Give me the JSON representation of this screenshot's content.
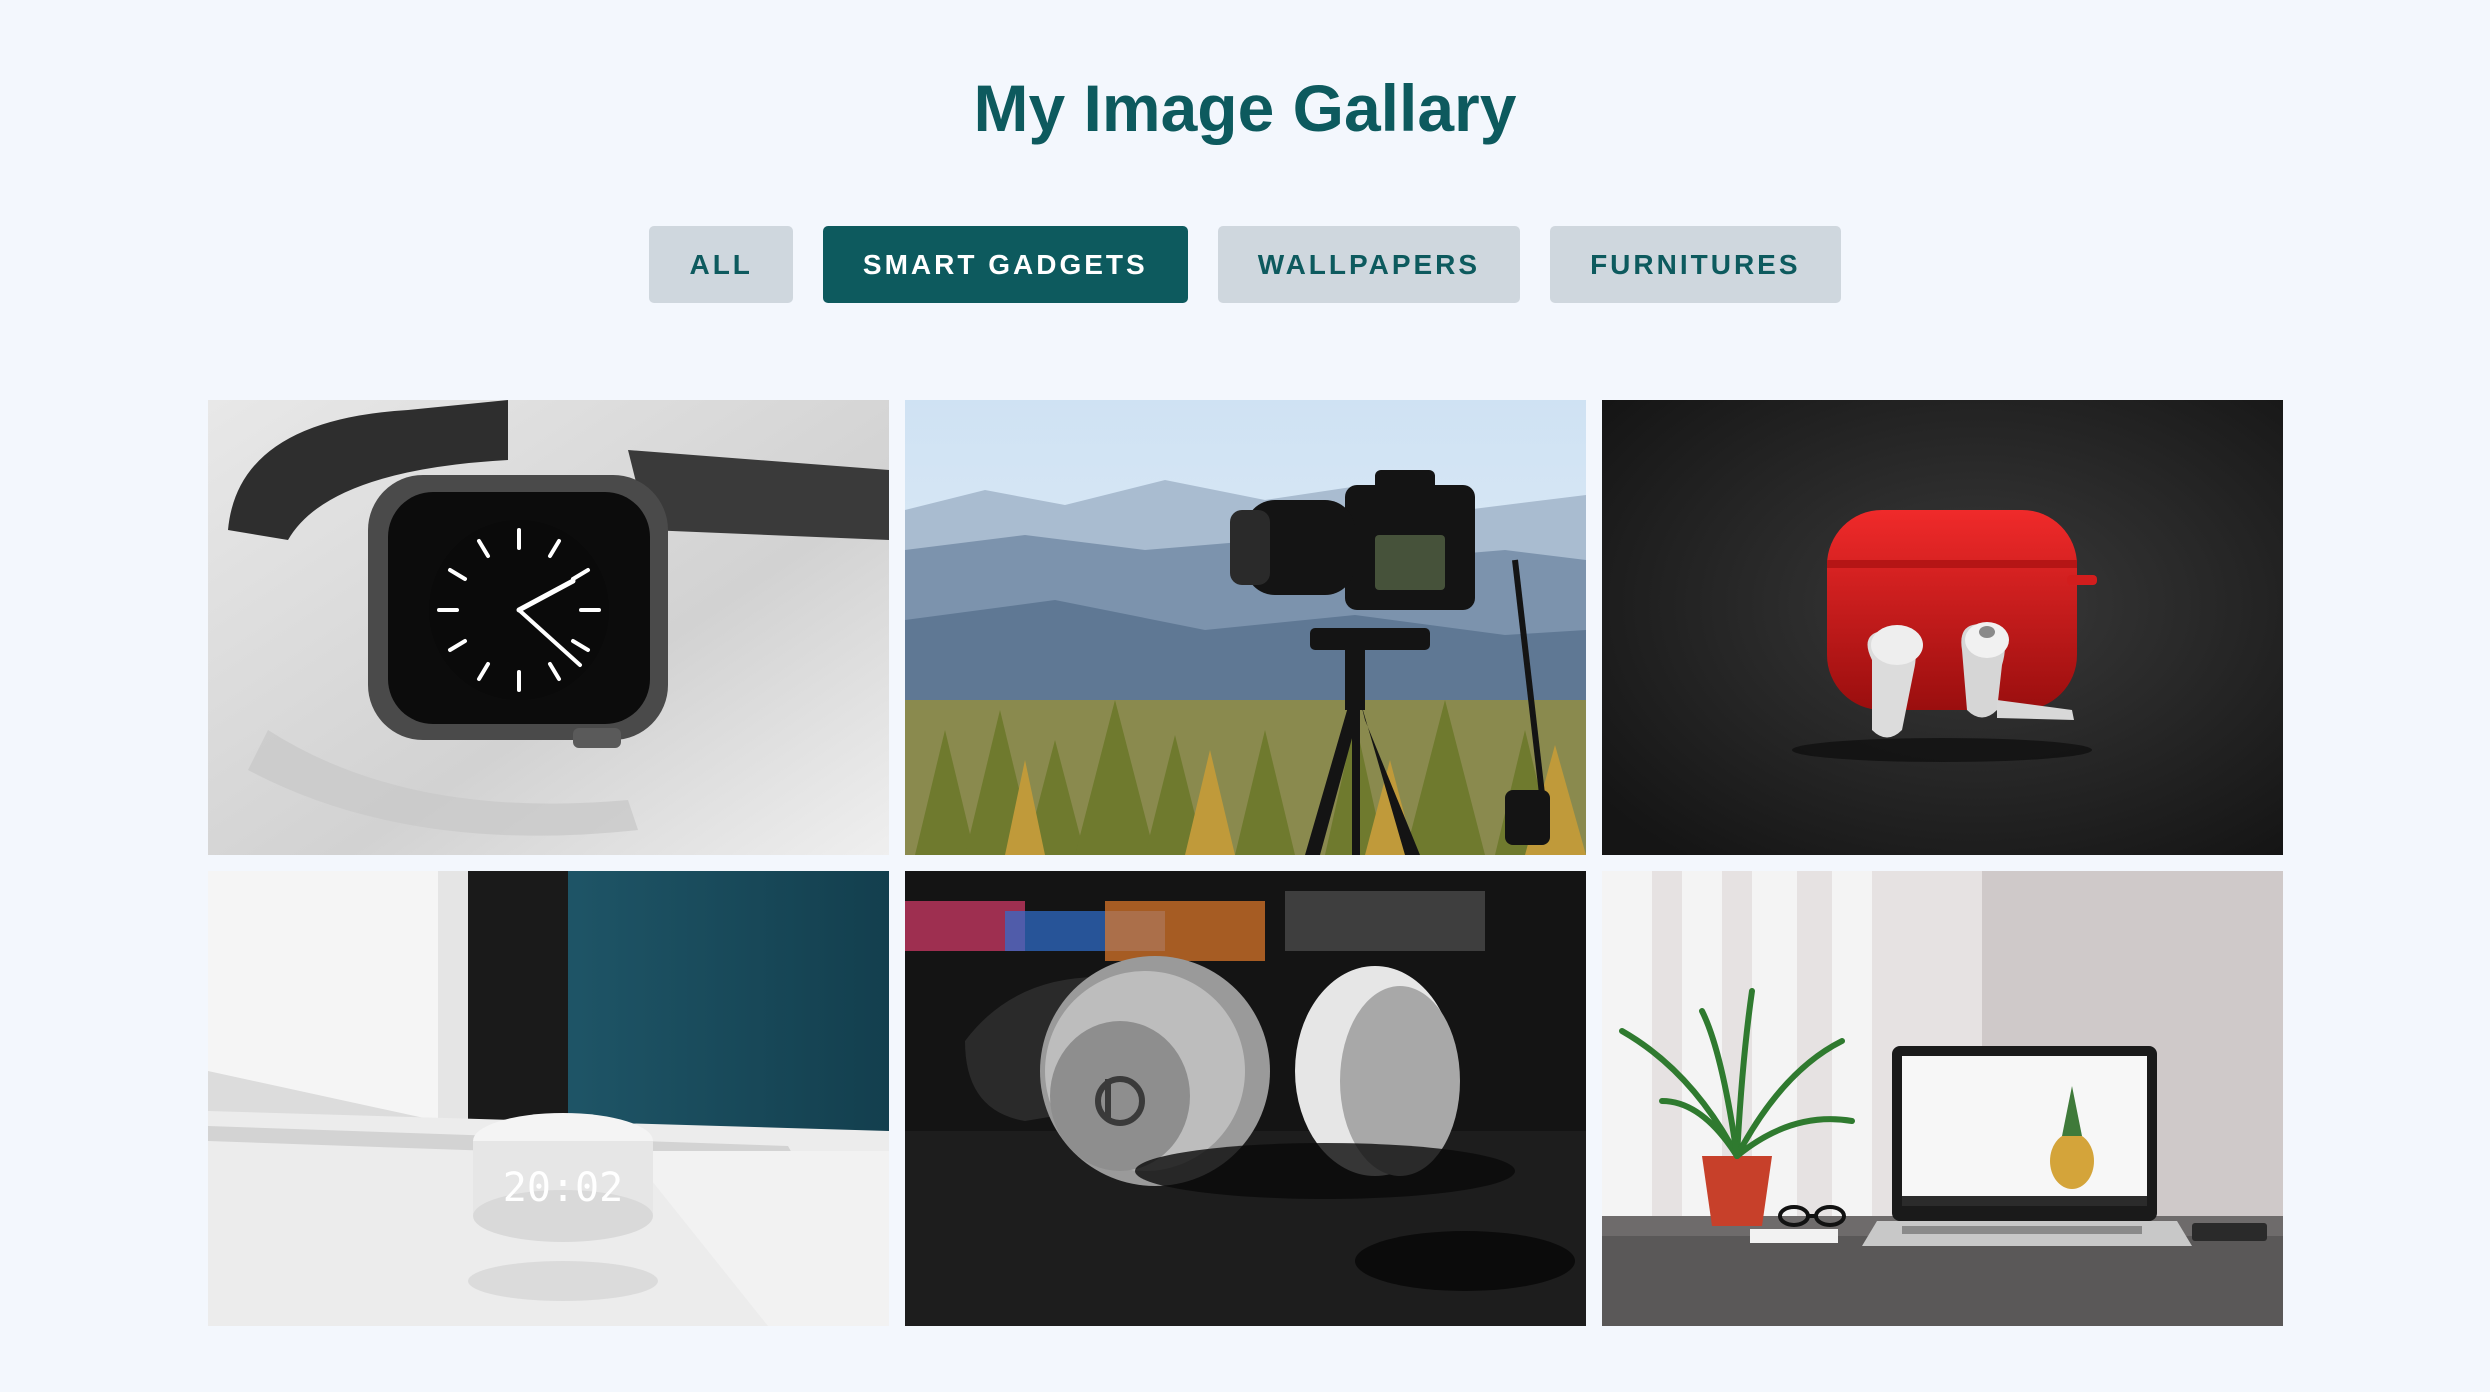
{
  "page": {
    "title": "My Image Gallary"
  },
  "filters": [
    {
      "label": "ALL",
      "active": false
    },
    {
      "label": "SMART GADGETS",
      "active": true
    },
    {
      "label": "WALLPAPERS",
      "active": false
    },
    {
      "label": "FURNITURES",
      "active": false
    }
  ],
  "gallery": {
    "images": [
      {
        "subject": "smart-watch"
      },
      {
        "subject": "camera-on-tripod"
      },
      {
        "subject": "earbuds-red-case"
      },
      {
        "subject": "smart-speaker",
        "display_text": "20:02"
      },
      {
        "subject": "headphones"
      },
      {
        "subject": "laptop-desk-plant"
      }
    ]
  },
  "colors": {
    "background": "#f3f7fd",
    "accent": "#0d5a5e",
    "button_inactive": "#cfd7de"
  }
}
